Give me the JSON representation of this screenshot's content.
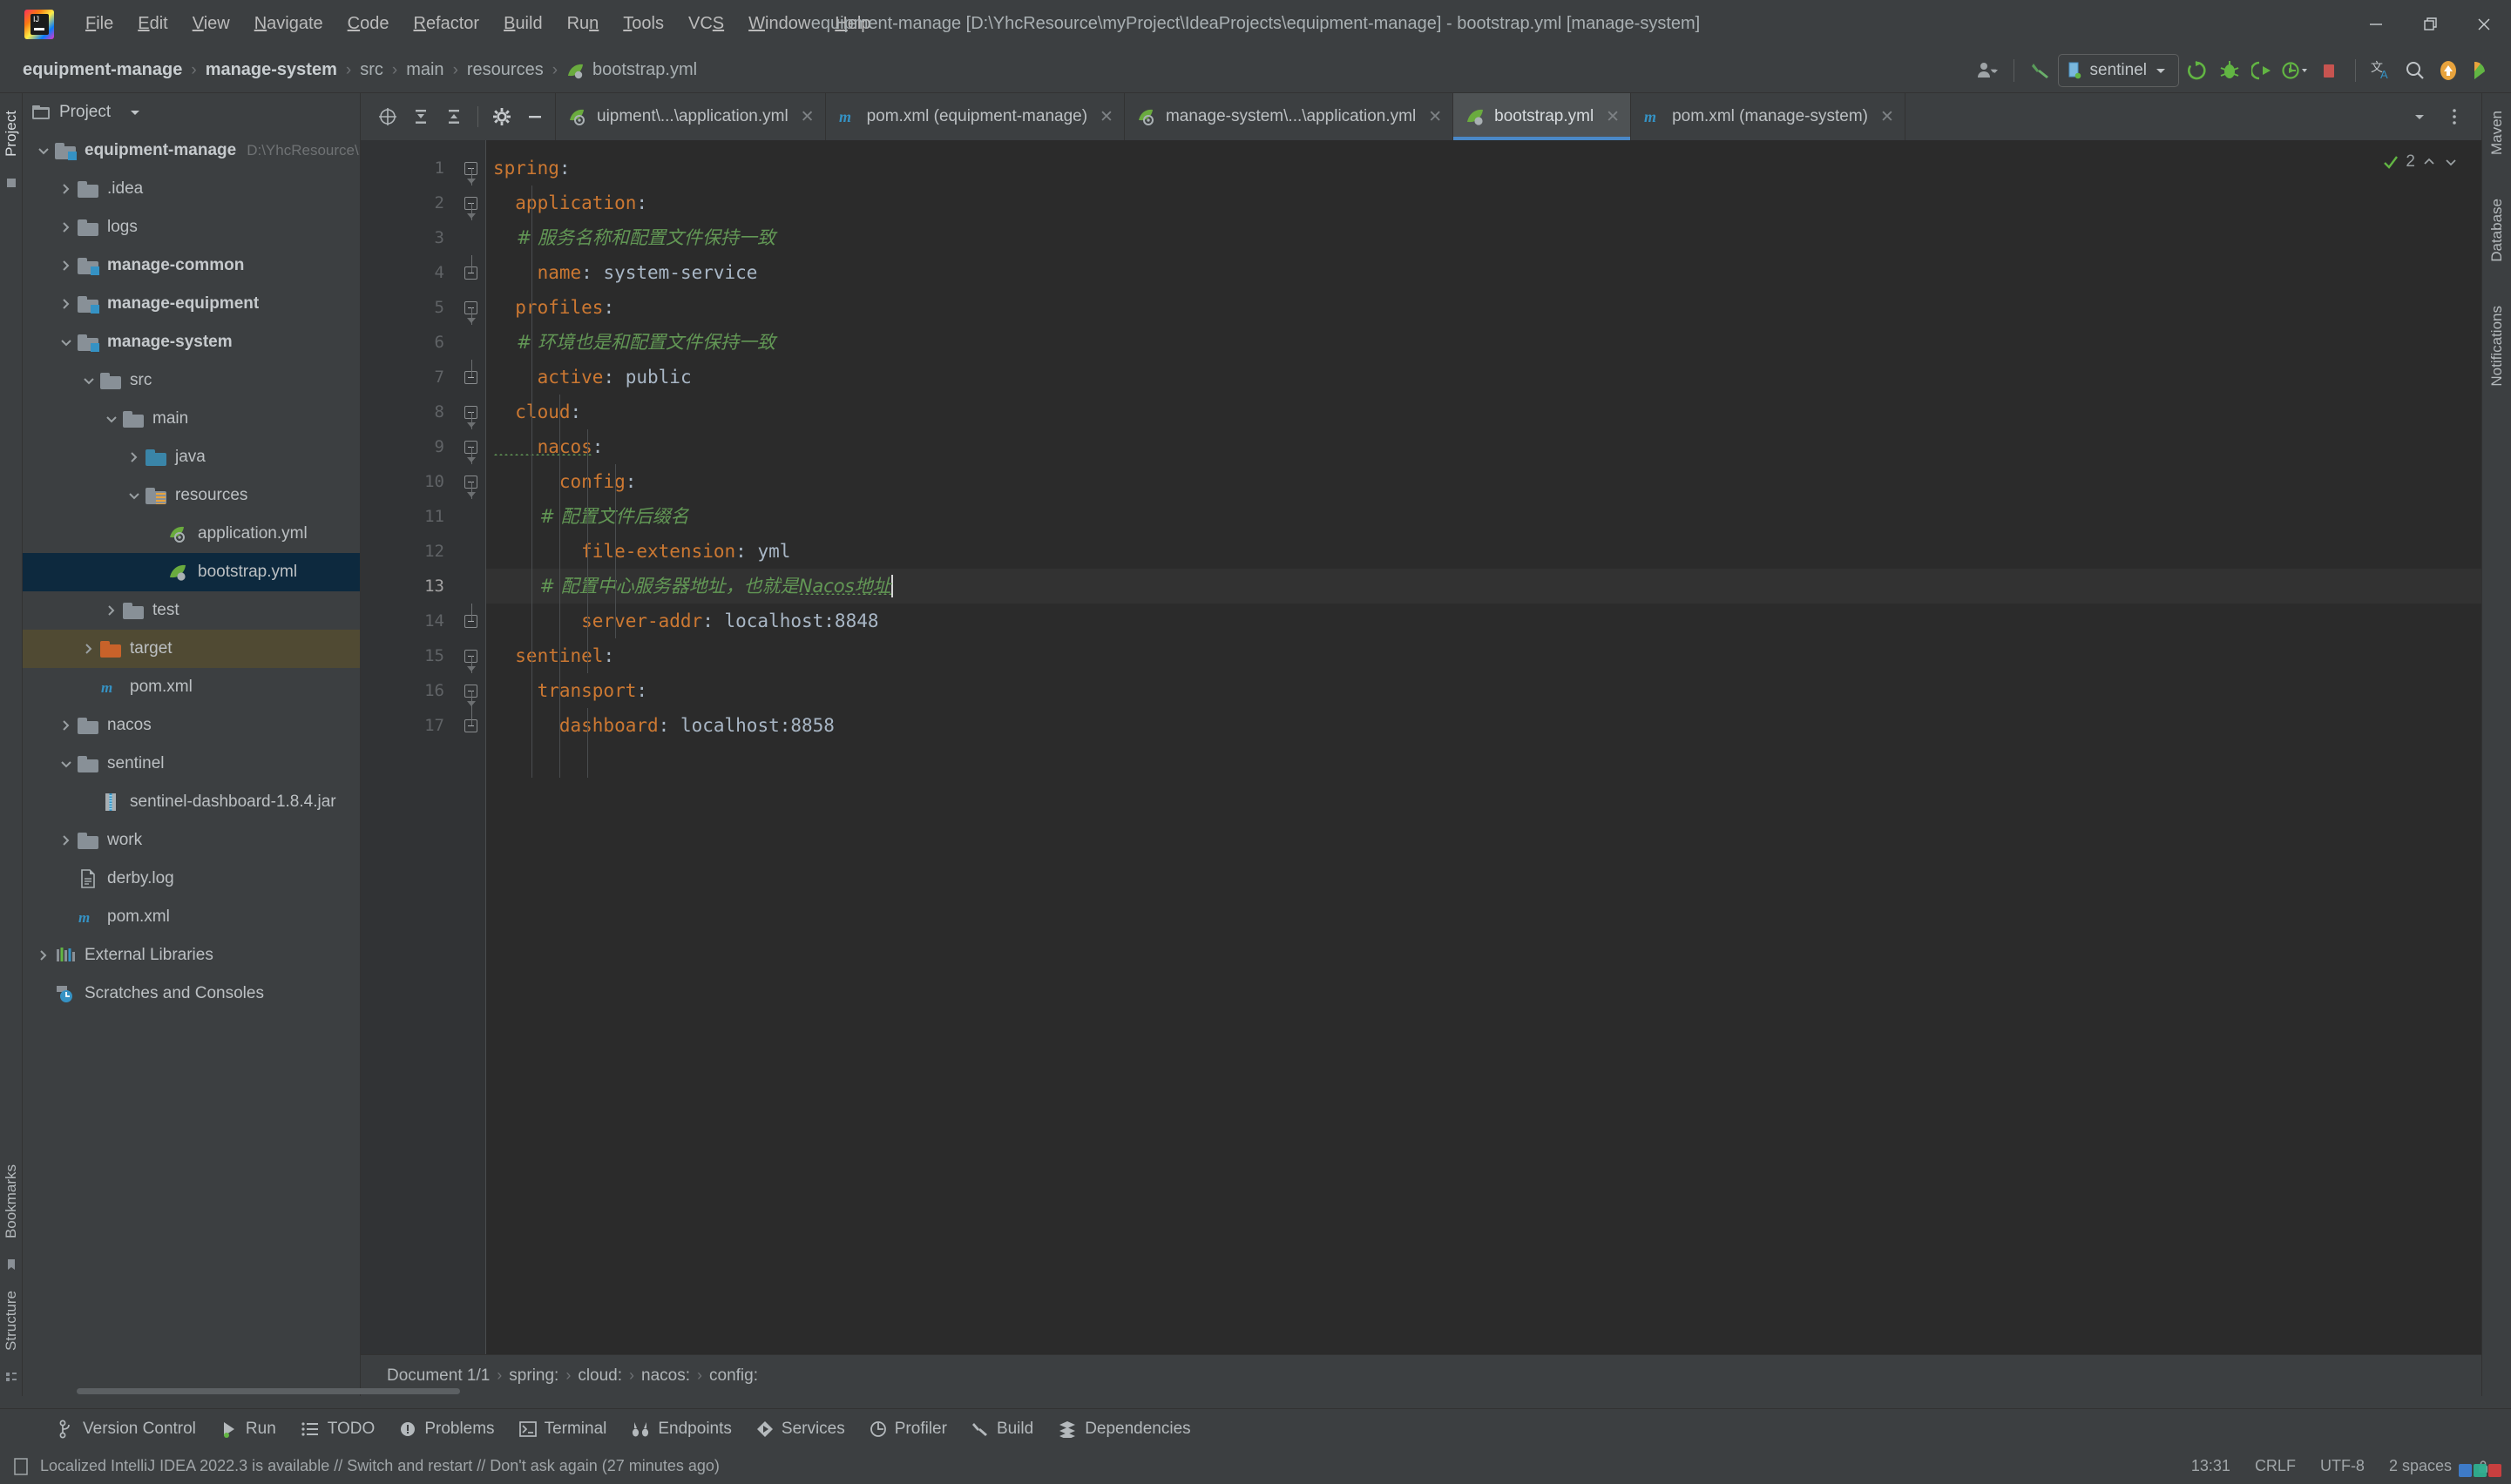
{
  "window": {
    "title": "equipment-manage [D:\\YhcResource\\myProject\\IdeaProjects\\equipment-manage] - bootstrap.yml [manage-system]",
    "minimize_label": "—",
    "restore_label": "❐",
    "close_label": "✕"
  },
  "menu": [
    {
      "label": "File",
      "mnemonic": "F"
    },
    {
      "label": "Edit",
      "mnemonic": "E"
    },
    {
      "label": "View",
      "mnemonic": "V"
    },
    {
      "label": "Navigate",
      "mnemonic": "N"
    },
    {
      "label": "Code",
      "mnemonic": "C"
    },
    {
      "label": "Refactor",
      "mnemonic": "R"
    },
    {
      "label": "Build",
      "mnemonic": "B"
    },
    {
      "label": "Run",
      "mnemonic": "n"
    },
    {
      "label": "Tools",
      "mnemonic": "T"
    },
    {
      "label": "VCS",
      "mnemonic": "S"
    },
    {
      "label": "Window",
      "mnemonic": "W"
    },
    {
      "label": "Help",
      "mnemonic": "H"
    }
  ],
  "navbar": {
    "breadcrumbs": [
      {
        "label": "equipment-manage",
        "bold": true,
        "icon": ""
      },
      {
        "label": "manage-system",
        "bold": true,
        "icon": ""
      },
      {
        "label": "src",
        "bold": false,
        "icon": ""
      },
      {
        "label": "main",
        "bold": false,
        "icon": ""
      },
      {
        "label": "resources",
        "bold": false,
        "icon": ""
      },
      {
        "label": "bootstrap.yml",
        "bold": false,
        "icon": "spring-leaf-icon"
      }
    ],
    "separator": "›",
    "run_config": "sentinel",
    "toolbar_icons": [
      "user-dropdown-icon",
      "build-hammer-icon",
      "run-config-selector",
      "rerun-icon",
      "debug-icon",
      "run-with-coverage-icon",
      "profiler-icon",
      "stop-icon",
      "translate-icon",
      "search-everywhere-icon",
      "update-icon",
      "ide-feature-icon"
    ]
  },
  "project_panel": {
    "title": "Project",
    "header_icons": [
      "project-view-icon",
      "chevron-down-icon"
    ],
    "tree": [
      {
        "label": "equipment-manage",
        "path": "D:\\YhcResource\\myProject\\IdeaP",
        "depth": 0,
        "arrow": "down",
        "icon": "module-folder-icon",
        "bold": true,
        "state": "normal"
      },
      {
        "label": ".idea",
        "path": "",
        "depth": 1,
        "arrow": "right",
        "icon": "folder-icon",
        "bold": false,
        "state": "normal"
      },
      {
        "label": "logs",
        "path": "",
        "depth": 1,
        "arrow": "right",
        "icon": "folder-icon",
        "bold": false,
        "state": "normal"
      },
      {
        "label": "manage-common",
        "path": "",
        "depth": 1,
        "arrow": "right",
        "icon": "module-folder-icon",
        "bold": true,
        "state": "normal"
      },
      {
        "label": "manage-equipment",
        "path": "",
        "depth": 1,
        "arrow": "right",
        "icon": "module-folder-icon",
        "bold": true,
        "state": "normal"
      },
      {
        "label": "manage-system",
        "path": "",
        "depth": 1,
        "arrow": "down",
        "icon": "module-folder-icon",
        "bold": true,
        "state": "normal"
      },
      {
        "label": "src",
        "path": "",
        "depth": 2,
        "arrow": "down",
        "icon": "folder-icon",
        "bold": false,
        "state": "normal"
      },
      {
        "label": "main",
        "path": "",
        "depth": 3,
        "arrow": "down",
        "icon": "folder-icon",
        "bold": false,
        "state": "normal"
      },
      {
        "label": "java",
        "path": "",
        "depth": 4,
        "arrow": "right",
        "icon": "source-root-icon",
        "bold": false,
        "state": "normal"
      },
      {
        "label": "resources",
        "path": "",
        "depth": 4,
        "arrow": "down",
        "icon": "resource-root-icon",
        "bold": false,
        "state": "normal"
      },
      {
        "label": "application.yml",
        "path": "",
        "depth": 5,
        "arrow": "none",
        "icon": "spring-config-icon",
        "bold": false,
        "state": "normal"
      },
      {
        "label": "bootstrap.yml",
        "path": "",
        "depth": 5,
        "arrow": "none",
        "icon": "spring-leaf-icon",
        "bold": false,
        "state": "selected"
      },
      {
        "label": "test",
        "path": "",
        "depth": 3,
        "arrow": "right",
        "icon": "folder-icon",
        "bold": false,
        "state": "normal"
      },
      {
        "label": "target",
        "path": "",
        "depth": 2,
        "arrow": "right",
        "icon": "excluded-folder-icon",
        "bold": false,
        "state": "excluded"
      },
      {
        "label": "pom.xml",
        "path": "",
        "depth": 2,
        "arrow": "none",
        "icon": "maven-icon",
        "bold": false,
        "state": "normal"
      },
      {
        "label": "nacos",
        "path": "",
        "depth": 1,
        "arrow": "right",
        "icon": "folder-icon",
        "bold": false,
        "state": "normal"
      },
      {
        "label": "sentinel",
        "path": "",
        "depth": 1,
        "arrow": "down",
        "icon": "folder-icon",
        "bold": false,
        "state": "normal"
      },
      {
        "label": "sentinel-dashboard-1.8.4.jar",
        "path": "",
        "depth": 2,
        "arrow": "none",
        "icon": "jar-icon",
        "bold": false,
        "state": "normal"
      },
      {
        "label": "work",
        "path": "",
        "depth": 1,
        "arrow": "right",
        "icon": "folder-icon",
        "bold": false,
        "state": "normal"
      },
      {
        "label": "derby.log",
        "path": "",
        "depth": 1,
        "arrow": "none",
        "icon": "log-file-icon",
        "bold": false,
        "state": "normal"
      },
      {
        "label": "pom.xml",
        "path": "",
        "depth": 1,
        "arrow": "none",
        "icon": "maven-icon",
        "bold": false,
        "state": "normal"
      },
      {
        "label": "External Libraries",
        "path": "",
        "depth": 0,
        "arrow": "right",
        "icon": "libraries-icon",
        "bold": false,
        "state": "normal"
      },
      {
        "label": "Scratches and Consoles",
        "path": "",
        "depth": 0,
        "arrow": "none",
        "icon": "scratches-icon",
        "bold": false,
        "state": "normal"
      }
    ]
  },
  "editor": {
    "tab_action_icons": [
      "locate-icon",
      "expand-all-icon",
      "collapse-all-icon",
      "settings-gear-icon",
      "hide-icon"
    ],
    "tabs": [
      {
        "label": "uipment\\...\\application.yml",
        "icon": "spring-config-icon",
        "active": false,
        "close": "✕"
      },
      {
        "label": "pom.xml (equipment-manage)",
        "icon": "maven-icon",
        "active": false,
        "close": "✕"
      },
      {
        "label": "manage-system\\...\\application.yml",
        "icon": "spring-config-icon",
        "active": false,
        "close": "✕"
      },
      {
        "label": "bootstrap.yml",
        "icon": "spring-leaf-icon",
        "active": true,
        "close": "✕"
      },
      {
        "label": "pom.xml (manage-system)",
        "icon": "maven-icon",
        "active": false,
        "close": "✕"
      }
    ],
    "tabs_right_icons": [
      "chevron-down-icon",
      "more-vertical-icon"
    ],
    "inspection": {
      "count": "2",
      "ok_icon": "checkmark-icon",
      "up_icon": "chevron-up-icon",
      "down_icon": "chevron-down-icon"
    },
    "current_line": 13,
    "lines": [
      {
        "n": 1,
        "indent": 0,
        "fold": "start",
        "tokens": [
          {
            "t": "k",
            "s": "spring"
          },
          {
            "t": "v",
            "s": ":"
          }
        ]
      },
      {
        "n": 2,
        "indent": 1,
        "fold": "start",
        "tokens": [
          {
            "t": "k",
            "s": "  application"
          },
          {
            "t": "v",
            "s": ":"
          }
        ]
      },
      {
        "n": 3,
        "indent": 2,
        "fold": "none",
        "tokens": [
          {
            "t": "cm",
            "s": "    # 服务名称和配置文件保持一致"
          }
        ]
      },
      {
        "n": 4,
        "indent": 2,
        "fold": "end",
        "tokens": [
          {
            "t": "k",
            "s": "    name"
          },
          {
            "t": "v",
            "s": ": system-service"
          }
        ]
      },
      {
        "n": 5,
        "indent": 1,
        "fold": "start",
        "tokens": [
          {
            "t": "k",
            "s": "  profiles"
          },
          {
            "t": "v",
            "s": ":"
          }
        ]
      },
      {
        "n": 6,
        "indent": 2,
        "fold": "none",
        "tokens": [
          {
            "t": "cm",
            "s": "    # 环境也是和配置文件保持一致"
          }
        ]
      },
      {
        "n": 7,
        "indent": 2,
        "fold": "end",
        "tokens": [
          {
            "t": "k",
            "s": "    active"
          },
          {
            "t": "v",
            "s": ": public"
          }
        ]
      },
      {
        "n": 8,
        "indent": 1,
        "fold": "start",
        "tokens": [
          {
            "t": "k",
            "s": "  cloud"
          },
          {
            "t": "v",
            "s": ":"
          }
        ]
      },
      {
        "n": 9,
        "indent": 2,
        "fold": "start",
        "tokens": [
          {
            "t": "k-typo",
            "s": "    nacos"
          },
          {
            "t": "v",
            "s": ":"
          }
        ]
      },
      {
        "n": 10,
        "indent": 3,
        "fold": "start",
        "tokens": [
          {
            "t": "k",
            "s": "      config"
          },
          {
            "t": "v",
            "s": ":"
          }
        ]
      },
      {
        "n": 11,
        "indent": 4,
        "fold": "none",
        "tokens": [
          {
            "t": "cm",
            "s": "        # 配置文件后缀名"
          }
        ]
      },
      {
        "n": 12,
        "indent": 4,
        "fold": "none",
        "tokens": [
          {
            "t": "k",
            "s": "        file-extension"
          },
          {
            "t": "v",
            "s": ": yml"
          }
        ]
      },
      {
        "n": 13,
        "indent": 4,
        "fold": "none",
        "tokens": [
          {
            "t": "cm",
            "s": "        # 配置中心服务器地址，也就是"
          },
          {
            "t": "cm-typo",
            "s": "Nacos地址"
          },
          {
            "t": "caret",
            "s": ""
          }
        ]
      },
      {
        "n": 14,
        "indent": 4,
        "fold": "end",
        "tokens": [
          {
            "t": "k",
            "s": "        server-addr"
          },
          {
            "t": "v",
            "s": ": localhost:8848"
          }
        ]
      },
      {
        "n": 15,
        "indent": 1,
        "fold": "start",
        "tokens": [
          {
            "t": "k",
            "s": "  sentinel"
          },
          {
            "t": "v",
            "s": ":"
          }
        ]
      },
      {
        "n": 16,
        "indent": 2,
        "fold": "start",
        "tokens": [
          {
            "t": "k",
            "s": "    transport"
          },
          {
            "t": "v",
            "s": ":"
          }
        ]
      },
      {
        "n": 17,
        "indent": 3,
        "fold": "end",
        "tokens": [
          {
            "t": "k",
            "s": "      dashboard"
          },
          {
            "t": "v",
            "s": ": localhost:8858"
          }
        ]
      }
    ],
    "breadcrumbs": [
      "Document 1/1",
      "spring:",
      "cloud:",
      "nacos:",
      "config:"
    ],
    "breadcrumb_separator": "›"
  },
  "left_strip": {
    "tabs": [
      "Project",
      "Bookmarks",
      "Structure"
    ]
  },
  "right_strip": {
    "tabs": [
      "Maven",
      "Database",
      "Notifications"
    ]
  },
  "tool_windows": [
    {
      "label": "Version Control",
      "icon": "branch-icon"
    },
    {
      "label": "Run",
      "icon": "run-icon"
    },
    {
      "label": "TODO",
      "icon": "todo-icon"
    },
    {
      "label": "Problems",
      "icon": "problems-icon"
    },
    {
      "label": "Terminal",
      "icon": "terminal-icon"
    },
    {
      "label": "Endpoints",
      "icon": "endpoints-icon"
    },
    {
      "label": "Services",
      "icon": "services-icon"
    },
    {
      "label": "Profiler",
      "icon": "profiler-icon"
    },
    {
      "label": "Build",
      "icon": "build-hammer-icon"
    },
    {
      "label": "Dependencies",
      "icon": "dependencies-icon"
    }
  ],
  "statusbar": {
    "message": "Localized IntelliJ IDEA 2022.3 is available // Switch and restart // Don't ask again (27 minutes ago)",
    "message_icon": "notification-icon",
    "time": "13:31",
    "line_separator": "CRLF",
    "encoding": "UTF-8",
    "indent": "2 spaces",
    "lock_icon": "lock-icon"
  },
  "colors": {
    "bg_panel": "#3c3f41",
    "bg_editor": "#2b2b2b",
    "gutter": "#313335",
    "accent_tab": "#4a88c7",
    "selection": "#0d293e",
    "excluded_row": "#504a33",
    "key": "#cc7832",
    "value": "#a9b7c6",
    "comment": "#629755",
    "text": "#bcc0c3",
    "muted": "#6f7274"
  }
}
